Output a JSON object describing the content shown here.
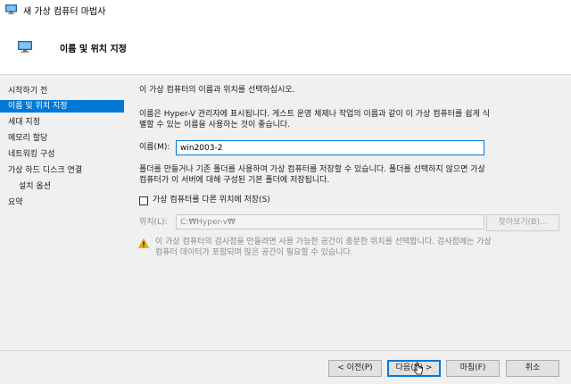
{
  "window": {
    "title": "새 가상 컴퓨터 마법사",
    "icon": "monitor-icon"
  },
  "header": {
    "title": "이름 및 위치 지정",
    "icon": "monitor-icon"
  },
  "sidebar": {
    "items": [
      {
        "label": "시작하기 전",
        "active": false,
        "sub": false
      },
      {
        "label": "이름 및 위치 지정",
        "active": true,
        "sub": false
      },
      {
        "label": "세대 지정",
        "active": false,
        "sub": false
      },
      {
        "label": "메모리 할당",
        "active": false,
        "sub": false
      },
      {
        "label": "네트워킹 구성",
        "active": false,
        "sub": false
      },
      {
        "label": "가상 하드 디스크 연결",
        "active": false,
        "sub": false
      },
      {
        "label": "설치 옵션",
        "active": false,
        "sub": true
      },
      {
        "label": "요약",
        "active": false,
        "sub": false
      }
    ]
  },
  "main": {
    "instruction": "이 가상 컴퓨터의 이름과 위치를 선택하십시오.",
    "description_line1": "이름은 Hyper-V 관리자에 표시됩니다. 게스트 운영 체제나 작업의 이름과 같이 이 가상 컴퓨터를 쉽게 식",
    "description_line2": "별할 수 있는 이름을 사용하는 것이 좋습니다.",
    "name_label": "이름(M):",
    "name_value": "win2003-2",
    "folder_line1": "폴더를 만들거나 기존 폴더를 사용하여 가상 컴퓨터를 저장할 수 있습니다. 폴더를 선택하지 않으면 가상",
    "folder_line2": "컴퓨터가 이 서버에 대해 구성된 기본 폴더에 저장됩니다.",
    "store_checkbox_label": "가상 컴퓨터를 다른 위치에 저장(S)",
    "store_checked": false,
    "location_label": "위치(L):",
    "location_value": "C:₩Hyper-v₩",
    "browse_label": "찾아보기(B)...",
    "warning_line1": "이 가상 컴퓨터의 검사점을 만들려면 사용 가능한 공간이 충분한 위치를 선택합니다. 검사점에는 가상",
    "warning_line2": "컴퓨터 데이터가 포함되며 많은 공간이 필요할 수 있습니다.",
    "warning_icon": "warning-icon"
  },
  "footer": {
    "prev_label": "< 이전(P)",
    "next_label": "다음(N) >",
    "finish_label": "마침(F)",
    "cancel_label": "취소"
  },
  "colors": {
    "accent": "#0078d7",
    "warning": "#e8b400"
  }
}
